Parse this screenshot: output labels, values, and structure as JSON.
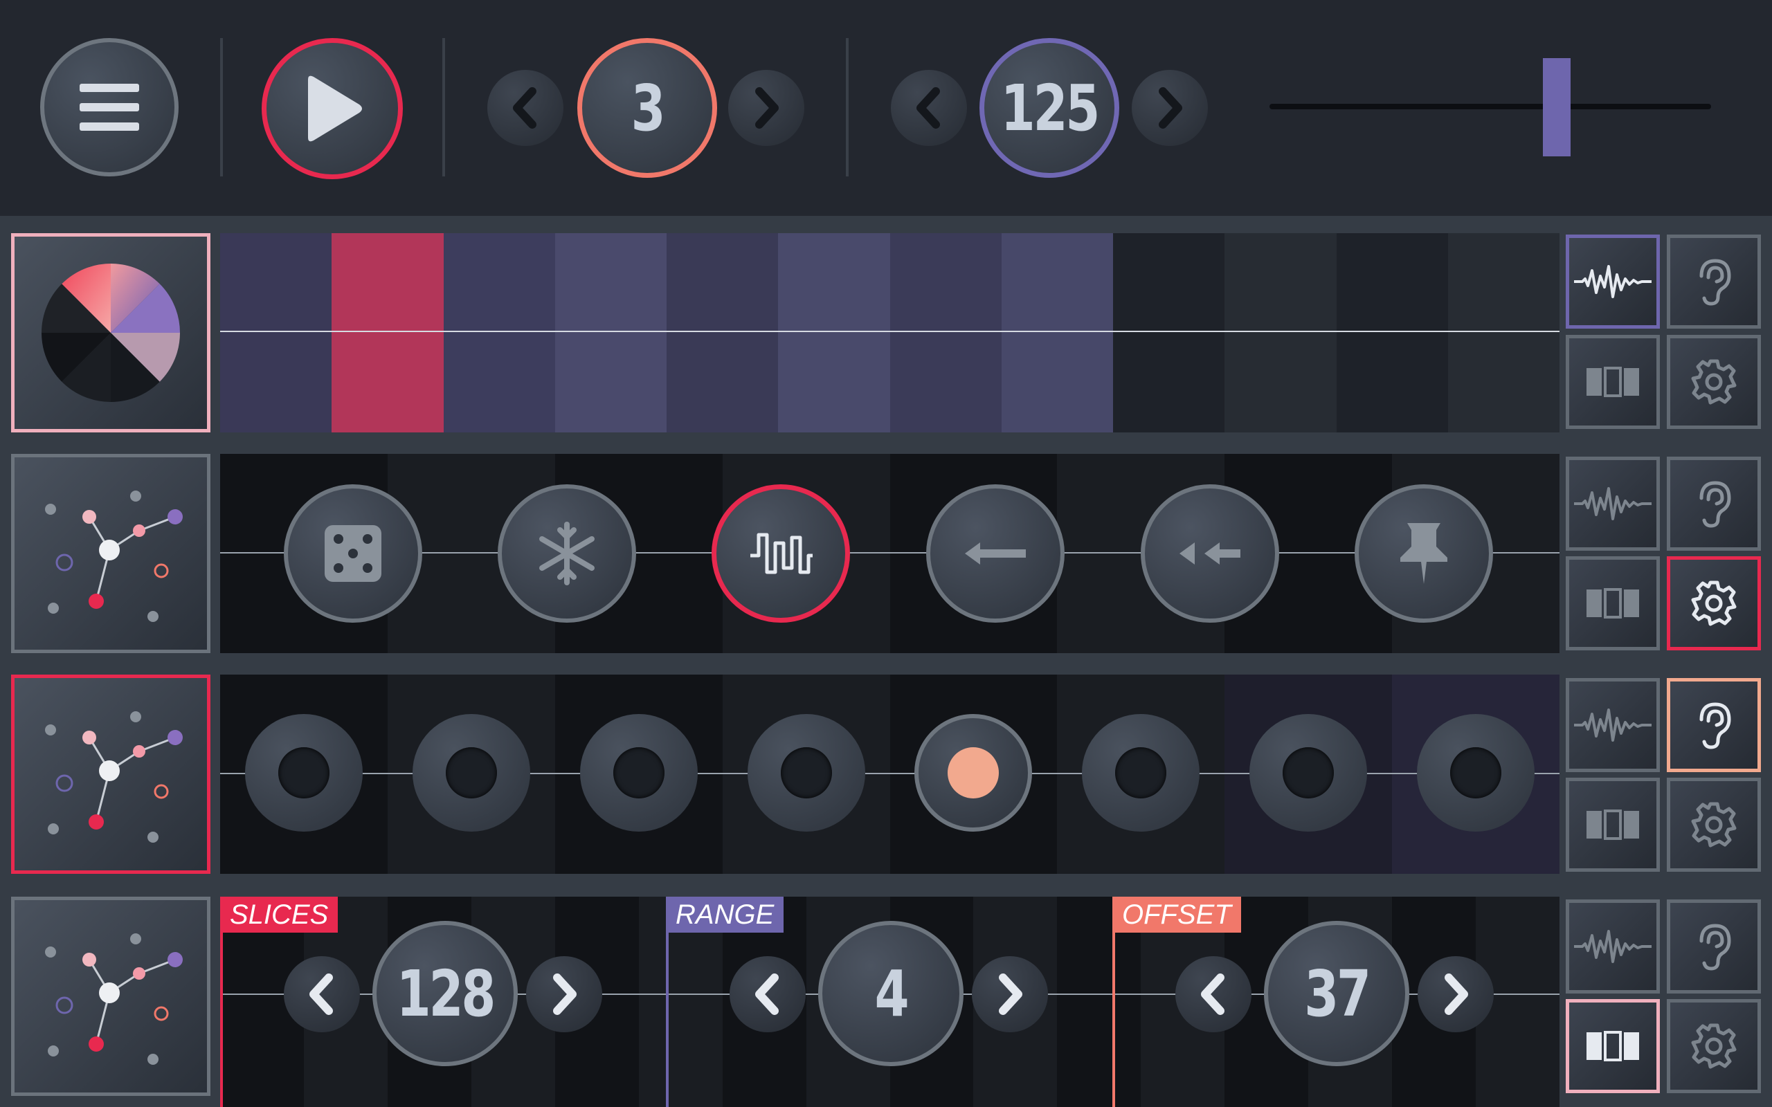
{
  "transport": {
    "pattern_value": "3",
    "tempo_value": "125",
    "slider_level": 0.66
  },
  "colors": {
    "play_ring": "#e8294f",
    "pattern_ring": "#f1786a",
    "tempo_ring": "#7068b4",
    "slider_handle": "#6e66ad",
    "active_red": "#e8294f",
    "active_peach": "#f2a98e",
    "active_pink": "#f0b0bd",
    "active_purple": "#6e66ad"
  },
  "icons": {
    "menu": "menu-icon",
    "play": "play-icon",
    "prev": "chevron-left-icon",
    "next": "chevron-right-icon",
    "waveform": "waveform-icon",
    "listen": "ear-icon",
    "split": "columns-icon",
    "settings": "gear-icon",
    "random": "dice-icon",
    "freeze": "snowflake-icon",
    "pulse": "pulse-wave-icon",
    "reverse": "arrow-left-icon",
    "rewind": "double-arrow-left-icon",
    "pin": "pin-icon",
    "pie": "pie-chart-icon",
    "network": "network-icon"
  },
  "track1": {
    "cell_colors": [
      "#3a3957",
      "#b23659",
      "#3d3d5d",
      "#4a4a6c",
      "#3a3a56",
      "#494a6b",
      "#3b3b58",
      "#474869",
      "#1e2229",
      "#272c33",
      "#1e2229",
      "#272c33"
    ]
  },
  "track2": {
    "modifiers": [
      "random",
      "freeze",
      "pulse",
      "reverse",
      "rewind",
      "pin"
    ],
    "active_modifier": 2
  },
  "track3": {
    "steps": 8,
    "active_step": 4
  },
  "track4": {
    "params": [
      {
        "label": "SLICES",
        "value": "128",
        "color": "#e8294f"
      },
      {
        "label": "RANGE",
        "value": "4",
        "color": "#6e66ad"
      },
      {
        "label": "OFFSET",
        "value": "37",
        "color": "#f1786a"
      }
    ]
  }
}
